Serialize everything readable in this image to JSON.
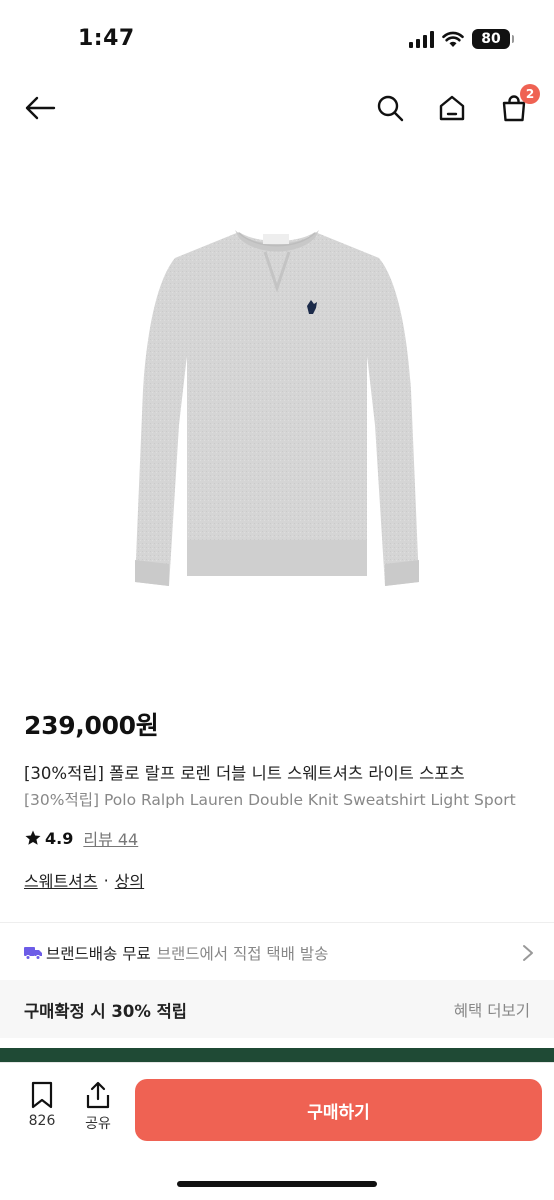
{
  "status_bar": {
    "time": "1:47",
    "battery": "80"
  },
  "nav": {
    "cart_count": "2"
  },
  "product": {
    "price": "239,000원",
    "title_ko": "[30%적립] 폴로 랄프 로렌 더블 니트 스웨트셔츠 라이트 스포츠",
    "title_en": "[30%적립] Polo Ralph Lauren Double Knit Sweatshirt Light Sport",
    "rating": "4.9",
    "review_label": "리뷰 44",
    "categories": [
      "스웨트셔츠",
      "상의"
    ],
    "category_separator": "·"
  },
  "shipping": {
    "title": "브랜드배송 무료",
    "desc": "브랜드에서 직접 택배 발송"
  },
  "points": {
    "text": "구매확정 시 30% 적립",
    "more": "혜택 더보기"
  },
  "bottom_bar": {
    "bookmark_count": "826",
    "share_label": "공유",
    "buy_label": "구매하기"
  },
  "colors": {
    "accent": "#ef6253",
    "badge": "#ef6253",
    "truck": "#6c5ce7",
    "strip": "#1f4a35",
    "sweatshirt": "#d6d6d6"
  },
  "icons": [
    "back-arrow-icon",
    "search-icon",
    "home-icon",
    "cart-icon",
    "star-icon",
    "truck-icon",
    "chevron-right-icon",
    "bookmark-icon",
    "share-icon"
  ]
}
